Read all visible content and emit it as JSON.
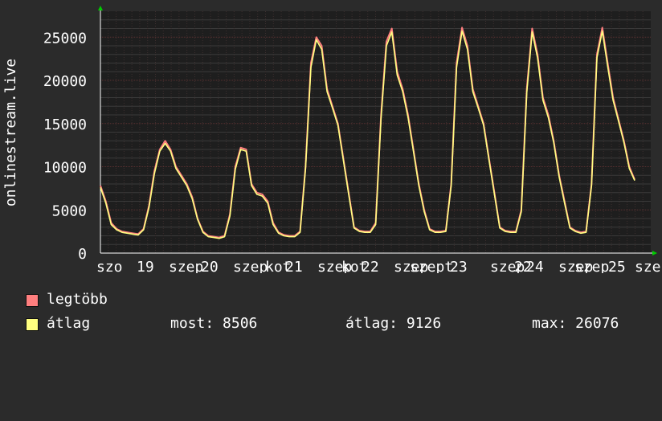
{
  "chart_data": {
    "type": "line",
    "ylabel": "onlinestream.live",
    "ylim": [
      0,
      28000
    ],
    "y_ticks": [
      0,
      5000,
      10000,
      15000,
      20000,
      25000
    ],
    "x_ticks": [
      "szo",
      "19",
      "szep",
      "20",
      "szep",
      "kot",
      "21",
      "szep",
      "kot",
      "22",
      "szep",
      "szept",
      "23",
      "szep",
      "22",
      "24",
      "szep",
      "szep",
      "25",
      "szep"
    ],
    "grid": true,
    "series": [
      {
        "name": "legtöbb",
        "color": "#ff7f7f",
        "values": [
          7800,
          6000,
          3500,
          2800,
          2500,
          2400,
          2300,
          2200,
          2800,
          5500,
          9500,
          12000,
          13000,
          12000,
          10000,
          9000,
          8000,
          6500,
          4000,
          2500,
          2000,
          1900,
          1800,
          2000,
          4500,
          10000,
          12200,
          12000,
          8000,
          7000,
          6800,
          6000,
          3500,
          2400,
          2100,
          2000,
          2000,
          2500,
          10000,
          22000,
          25000,
          24000,
          19000,
          17000,
          15000,
          11000,
          7000,
          3000,
          2600,
          2500,
          2500,
          3500,
          16000,
          24500,
          26000,
          21000,
          19000,
          16000,
          12000,
          8000,
          5000,
          2800,
          2500,
          2500,
          2600,
          8000,
          22000,
          26100,
          24000,
          19000,
          17000,
          15000,
          11000,
          7000,
          3000,
          2600,
          2500,
          2500,
          5000,
          19000,
          26000,
          23000,
          18000,
          16000,
          13000,
          9000,
          6000,
          3000,
          2600,
          2400,
          2500,
          8000,
          23000,
          26100,
          22000,
          18000,
          15500,
          13000,
          10000,
          8500
        ]
      },
      {
        "name": "átlag",
        "color": "#ffff80",
        "values": [
          7600,
          5800,
          3300,
          2700,
          2400,
          2300,
          2200,
          2100,
          2700,
          5300,
          9200,
          11800,
          12700,
          11800,
          9800,
          8800,
          7800,
          6300,
          3900,
          2400,
          1900,
          1800,
          1700,
          1900,
          4300,
          9700,
          12000,
          11800,
          7800,
          6800,
          6600,
          5800,
          3300,
          2300,
          2000,
          1900,
          1900,
          2400,
          9800,
          21500,
          24700,
          23600,
          18700,
          16800,
          14800,
          10800,
          6800,
          2900,
          2500,
          2400,
          2400,
          3300,
          15600,
          24000,
          25600,
          20600,
          18700,
          15700,
          11800,
          7800,
          4800,
          2700,
          2400,
          2400,
          2500,
          7800,
          21500,
          25700,
          23600,
          18700,
          16800,
          14800,
          10800,
          6800,
          2900,
          2500,
          2400,
          2400,
          4800,
          18600,
          25600,
          22600,
          17700,
          15700,
          12800,
          8800,
          5800,
          2900,
          2500,
          2300,
          2400,
          7800,
          22600,
          25700,
          21600,
          17700,
          15300,
          12800,
          9800,
          8400
        ]
      }
    ]
  },
  "legend": {
    "max_series_label": "legtöbb",
    "avg_series_label": "átlag",
    "stats": {
      "current": "most: 8506",
      "average": "átlag: 9126",
      "maximum": "max: 26076"
    }
  }
}
